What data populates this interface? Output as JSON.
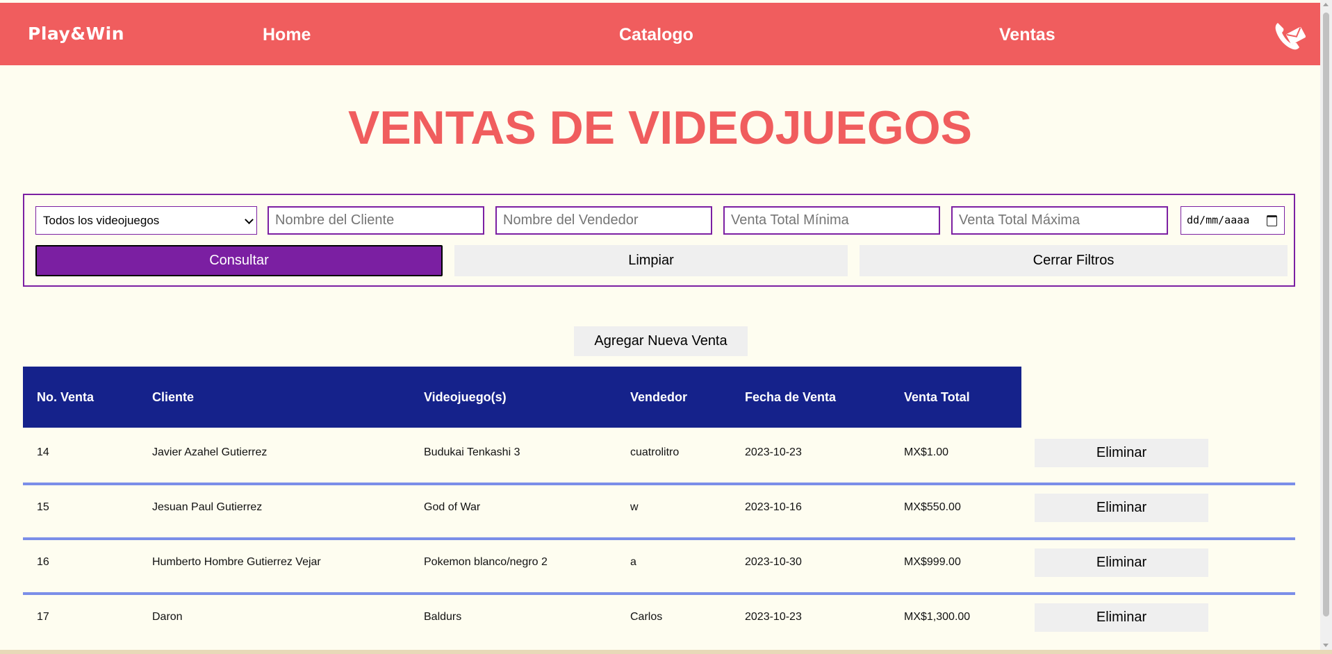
{
  "nav": {
    "logo": "Play&Win",
    "links": [
      "Home",
      "Catalogo",
      "Ventas"
    ],
    "contact_icon": "phone-envelope-icon"
  },
  "page": {
    "title": "VENTAS DE VIDEOJUEGOS"
  },
  "filters": {
    "game_select": {
      "value": "Todos los videojuegos"
    },
    "client": {
      "placeholder": "Nombre del Cliente"
    },
    "seller": {
      "placeholder": "Nombre del Vendedor"
    },
    "min_total": {
      "placeholder": "Venta Total Mínima"
    },
    "max_total": {
      "placeholder": "Venta Total Máxima"
    },
    "date": {
      "value": "dd/mm/aaaa"
    },
    "consult_label": "Consultar",
    "clear_label": "Limpiar",
    "close_label": "Cerrar Filtros"
  },
  "add_label": "Agregar Nueva Venta",
  "table": {
    "headers": [
      "No. Venta",
      "Cliente",
      "Videojuego(s)",
      "Vendedor",
      "Fecha de Venta",
      "Venta Total"
    ],
    "rows": [
      {
        "no": "14",
        "cliente": "Javier Azahel Gutierrez",
        "juego": "Budukai Tenkashi 3",
        "vendedor": "cuatrolitro",
        "fecha": "2023-10-23",
        "total": "MX$1.00"
      },
      {
        "no": "15",
        "cliente": "Jesuan Paul Gutierrez",
        "juego": "God of War",
        "vendedor": "w",
        "fecha": "2023-10-16",
        "total": "MX$550.00"
      },
      {
        "no": "16",
        "cliente": "Humberto Hombre Gutierrez Vejar",
        "juego": "Pokemon blanco/negro 2",
        "vendedor": "a",
        "fecha": "2023-10-30",
        "total": "MX$999.00"
      },
      {
        "no": "17",
        "cliente": "Daron",
        "juego": "Baldurs",
        "vendedor": "Carlos",
        "fecha": "2023-10-23",
        "total": "MX$1,300.00"
      }
    ],
    "delete_label": "Eliminar"
  },
  "colors": {
    "accent": "#f05d5e",
    "purple": "#7b1fa2",
    "table_header": "#15228b",
    "row_separator": "#7b8ee8",
    "background": "#fefdf0"
  }
}
